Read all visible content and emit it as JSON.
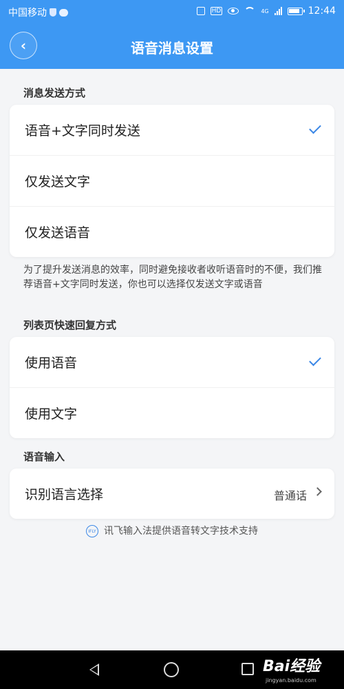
{
  "status_bar": {
    "carrier": "中国移动",
    "network": "4G",
    "time": "12:44"
  },
  "header": {
    "title": "语音消息设置",
    "back_icon": "chevron-left-icon"
  },
  "sections": [
    {
      "title": "消息发送方式",
      "options": [
        {
          "label": "语音+文字同时发送",
          "selected": true
        },
        {
          "label": "仅发送文字",
          "selected": false
        },
        {
          "label": "仅发送语音",
          "selected": false
        }
      ],
      "note": "为了提升发送消息的效率，同时避免接收者收听语音时的不便，我们推荐语音+文字同时发送，你也可以选择仅发送文字或语音"
    },
    {
      "title": "列表页快速回复方式",
      "options": [
        {
          "label": "使用语音",
          "selected": true
        },
        {
          "label": "使用文字",
          "selected": false
        }
      ]
    },
    {
      "title": "语音输入",
      "row": {
        "label": "识别语言选择",
        "value": "普通话"
      }
    }
  ],
  "footer_note": "讯飞输入法提供语音转文字技术支持",
  "ifly_logo_text": "IFLY",
  "watermark": {
    "text": "Bai经验",
    "sub": "jingyan.baidu.com"
  },
  "colors": {
    "header": "#3d98f3",
    "accent": "#3b87e6",
    "background": "#f4f5f7"
  }
}
